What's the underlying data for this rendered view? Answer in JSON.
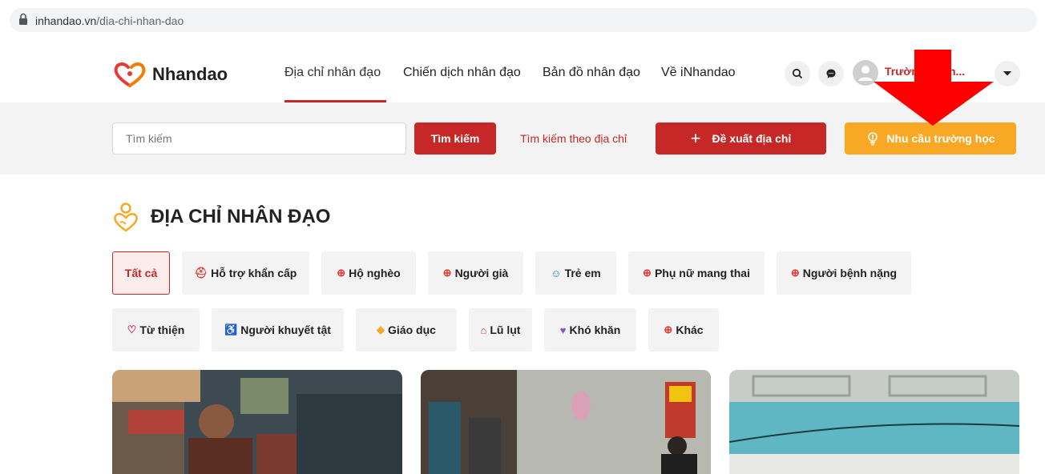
{
  "browser": {
    "url_host": "inhandao.vn",
    "url_path": "/dia-chi-nhan-dao"
  },
  "header": {
    "logo_text": "Nhandao",
    "nav": [
      "Địa chỉ nhân đạo",
      "Chiến dịch nhân đạo",
      "Bản đồ nhân đạo",
      "Về iNhandao"
    ],
    "username": "Trường Thon..."
  },
  "search": {
    "placeholder": "Tìm kiếm",
    "button": "Tìm kiếm",
    "address_link": "Tìm kiếm theo địa chỉ",
    "suggest_button": "Đề xuất địa chỉ",
    "school_button": "Nhu cầu trường học"
  },
  "section": {
    "title": "ĐỊA CHỈ NHÂN ĐẠO"
  },
  "categories": [
    "Tất cả",
    "Hỗ trợ khẩn cấp",
    "Hộ nghèo",
    "Người già",
    "Trẻ em",
    "Phụ nữ mang thai",
    "Người bệnh nặng",
    "Từ thiện",
    "Người khuyết tật",
    "Giáo dục",
    "Lũ lụt",
    "Khó khăn",
    "Khác"
  ],
  "colors": {
    "accent": "#c62828",
    "school": "#f9a825",
    "annotation": "#ff0000"
  }
}
